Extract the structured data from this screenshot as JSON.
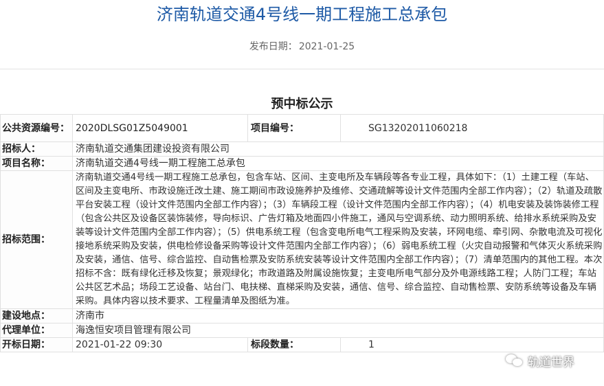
{
  "page_title": "济南轨道交通4号线一期工程施工总承包",
  "publish": {
    "label": "发布日期：",
    "date": "2021-01-25"
  },
  "section_title": "预中标公示",
  "rows": {
    "public_resource_no": {
      "label": "公共资源编号：",
      "value": "2020DLSG01Z5049001"
    },
    "project_no": {
      "label": "项目编号：",
      "value": "SG13202011060218"
    },
    "tenderer": {
      "label": "招标人：",
      "value": "济南轨道交通集团建设投资有限公司"
    },
    "project_name": {
      "label": "项目名称：",
      "value": "济南轨道交通4号线一期工程施工总承包"
    },
    "scope": {
      "label": "招标范围：",
      "value": "济南轨道交通4号线一期工程施工总承包，包含车站、区间、主变电所及车辆段等各专业工程，具体如下：（1）土建工程（车站、区间及主变电所、市政设施迁改土建、施工期间市政设施养护及维修、交通疏解等设计文件范围内全部工作内容）；（2）轨道及疏散平台安装工程（设计文件范围内全部工作内容）；（3）车辆段工程（设计文件范围内全部工作内容）；（4）机电安装及装饰装修工程（包含公共区及设备区装饰装修，导向标识、广告灯箱及地面四小件施工，通风与空调系统、动力照明系统、给排水系统采购及安装等设计文件范围内全部工作内容）；（5）供电系统工程（包含变电所电气工程采购及安装，环网电缆、牵引网、杂散电流及可视化接地系统采购及安装，供电检修设备采购等设计文件范围内全部工作内容）；（6）弱电系统工程（火灾自动报警和气体灭火系统采购及安装，通信、信号、综合监控、自动售检票及安防系统安装等设计文件范围内全部工作内容）；（7）清单范围内的其他工程。本次招标不含：既有绿化迁移及恢复；景观绿化；市政道路及附属设施恢复；主变电所电气部分及外电源线路工程；人防门工程；车站公共区艺术品；场段工艺设备、站台门、电扶梯、直梯采购及安装，通信、信号、综合监控、自动售检票、安防系统等设备及车辆采购。具体内容以技术要求、工程量清单及图纸为准。"
    },
    "location": {
      "label": "建设地点：",
      "value": "济南市"
    },
    "agent": {
      "label": "代理单位：",
      "value": "海逸恒安项目管理有限公司"
    },
    "open_date": {
      "label": "开标日期：",
      "value": "2021-01-22 09:30"
    },
    "lot_count": {
      "label": "标段数量：",
      "value": "1"
    }
  },
  "watermark": {
    "text": "轨道世界",
    "icon": "wechat-icon"
  }
}
